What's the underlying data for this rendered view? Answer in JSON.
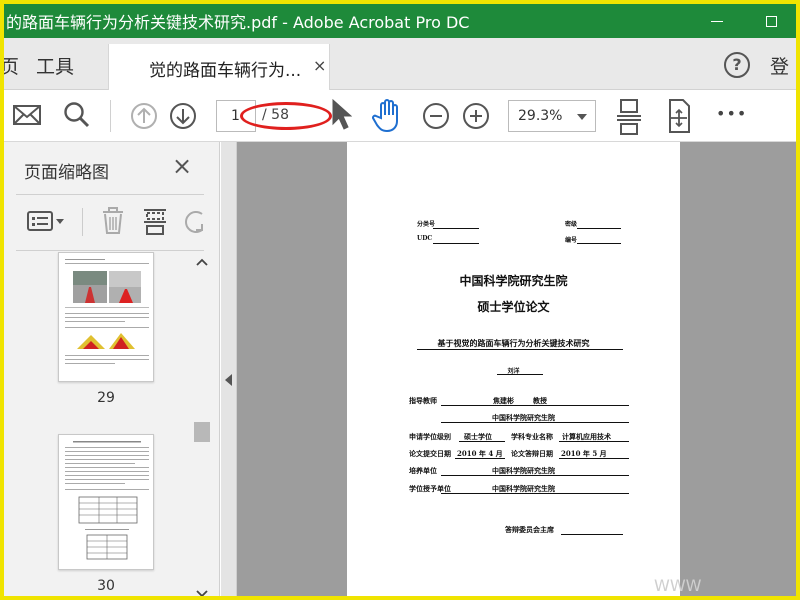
{
  "window": {
    "title": "的路面车辆行为分析关键技术研究.pdf - Adobe Acrobat Pro DC"
  },
  "tabs": {
    "cut_left": "页",
    "tools": "工具",
    "document": "觉的路面车辆行为...",
    "close": "×",
    "help": "?",
    "login_cut": "登"
  },
  "toolbar": {
    "current_page": "1",
    "total_pages": "/ 58",
    "zoom": "29.3%",
    "more": "•••"
  },
  "left_panel": {
    "title": "页面缩略图",
    "close": "×",
    "thumbnails": [
      {
        "label": "29"
      },
      {
        "label": "30"
      }
    ]
  },
  "page": {
    "class_no": "分类号",
    "secret": "密级",
    "udc": "UDC",
    "number": "编号",
    "institution": "中国科学院研究生院",
    "degree": "硕士学位论文",
    "thesis_title": "基于视觉的路面车辆行为分析关键技术研究",
    "author": "刘洋",
    "advisor_label": "指导教师",
    "advisor_name": "焦建彬",
    "advisor_title": "教授",
    "advisor_unit": "中国科学院研究生院",
    "degree_level_label": "申请学位级别",
    "degree_level": "硕士学位",
    "major_label": "学科专业名称",
    "major": "计算机应用技术",
    "submit_label": "论文提交日期",
    "submit_date": "2010 年 4 月",
    "defense_label": "论文答辩日期",
    "defense_date": "2010 年 5 月",
    "training_unit_label": "培养单位",
    "training_unit": "中国科学院研究生院",
    "grant_unit_label": "学位授予单位",
    "grant_unit": "中国科学院研究生院",
    "committee": "答辩委员会主席"
  },
  "watermark": "WWW",
  "colors": {
    "titlebar": "#1e8a3a",
    "highlight": "#e0201e",
    "outer_border": "#f0e400"
  }
}
